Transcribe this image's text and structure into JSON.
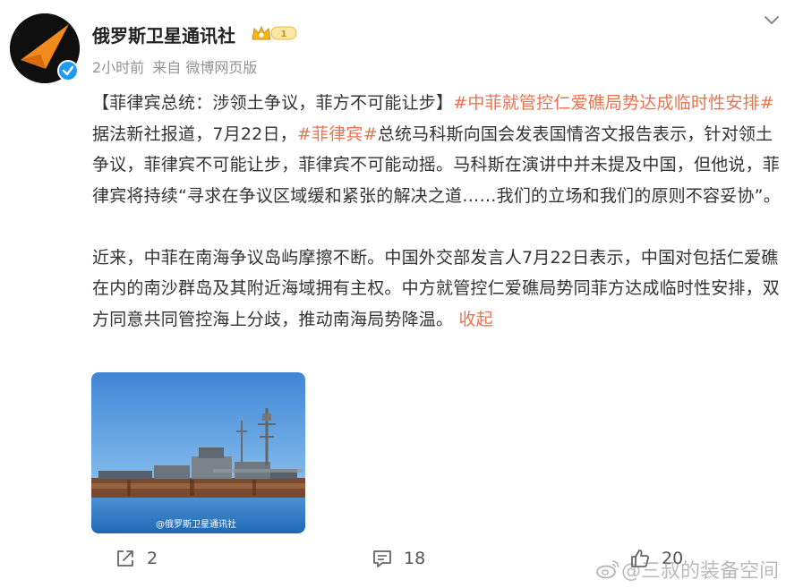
{
  "post": {
    "author": "俄罗斯卫星通讯社",
    "badge_level": "1",
    "time": "2小时前",
    "source": "来自 微博网页版",
    "content": {
      "para1": [
        {
          "text": "【菲律宾总统：涉领土争议，菲方不可能让步】",
          "link": false
        },
        {
          "text": "#中菲就管控仁爱礁局势达成临时性安排#",
          "link": true
        },
        {
          "text": " 据法新社报道，7月22日，",
          "link": false
        },
        {
          "text": "#菲律宾#",
          "link": true
        },
        {
          "text": "总统马科斯向国会发表国情咨文报告表示，针对领土争议，菲律宾不可能让步，菲律宾不可能动摇。马科斯在演讲中并未提及中国，但他说，菲律宾将持续“寻求在争议区域缓和紧张的解决之道……我们的立场和我们的原则不容妥协”。",
          "link": false
        }
      ],
      "para2": [
        {
          "text": "近来，中菲在南海争议岛屿摩擦不断。中国外交部发言人7月22日表示，中国对包括仁爱礁在内的南沙群岛及其附近海域拥有主权。中方就管控仁爱礁局势同菲方达成临时性安排，双方同意共同管控海上分歧，推动南海局势降温。",
          "link": false
        },
        {
          "text": " 收起",
          "link": true
        }
      ]
    },
    "image_watermark": "@俄罗斯卫星通讯社",
    "stats": {
      "repost": "2",
      "comment": "18",
      "like": "20"
    }
  },
  "watermark": "@三叔的装备空间",
  "colors": {
    "link": "#eb7350",
    "verified": "#1e9bf0",
    "meta": "#939393"
  },
  "icons": [
    "sputnik-logo-icon",
    "verified-icon",
    "vip-crown-icon",
    "chevron-down-icon",
    "repost-icon",
    "comment-icon",
    "like-icon",
    "weibo-logo-icon"
  ]
}
